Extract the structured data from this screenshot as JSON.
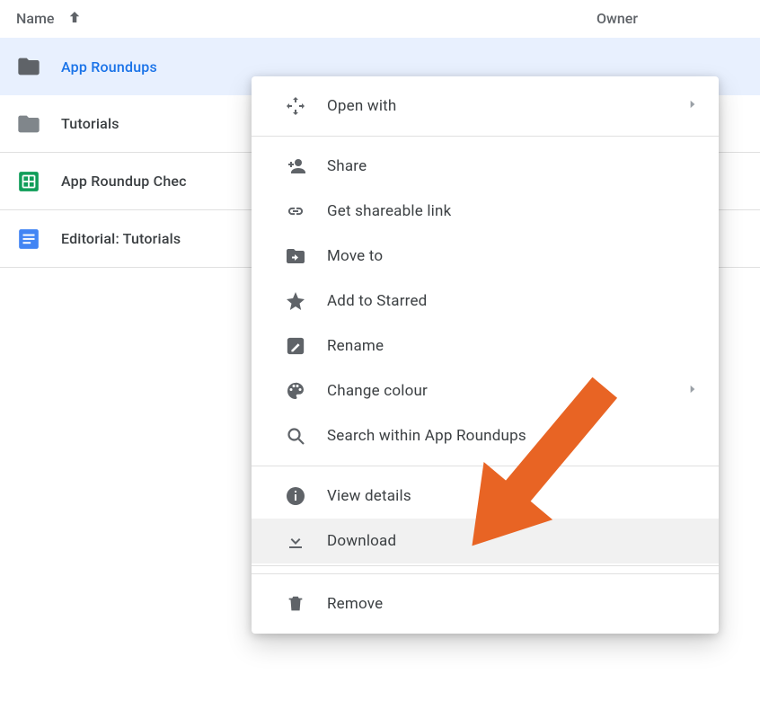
{
  "header": {
    "name_label": "Name",
    "owner_label": "Owner",
    "sort_direction": "asc"
  },
  "files": [
    {
      "label": "App Roundups",
      "type": "folder",
      "selected": true
    },
    {
      "label": "Tutorials",
      "type": "folder",
      "selected": false
    },
    {
      "label": "App Roundup Chec",
      "type": "sheets",
      "selected": false
    },
    {
      "label": "Editorial: Tutorials",
      "type": "docs",
      "selected": false
    }
  ],
  "menu": {
    "open_with": "Open with",
    "share": "Share",
    "get_link": "Get shareable link",
    "move_to": "Move to",
    "add_starred": "Add to Starred",
    "rename": "Rename",
    "change_colour": "Change colour",
    "search_within": "Search within App Roundups",
    "view_details": "View details",
    "download": "Download",
    "remove": "Remove"
  },
  "colors": {
    "accent": "#1a73e8",
    "arrow": "#e86424"
  }
}
